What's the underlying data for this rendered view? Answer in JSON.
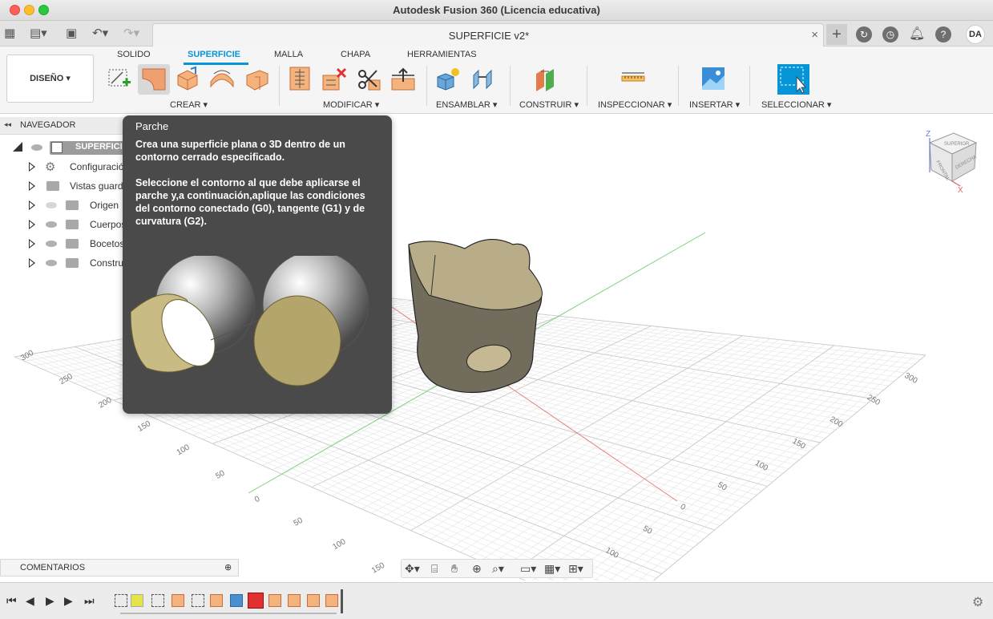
{
  "window": {
    "title": "Autodesk Fusion 360 (Licencia educativa)"
  },
  "tabbar": {
    "document_title": "SUPERFICIE v2*",
    "close_glyph": "×",
    "plus_glyph": "+",
    "user_initials": "DA"
  },
  "ribbon": {
    "workspace": "DISEÑO ▾",
    "tabs": [
      "SOLIDO",
      "SUPERFICIE",
      "MALLA",
      "CHAPA",
      "HERRAMIENTAS"
    ],
    "active_tab": "SUPERFICIE",
    "groups": [
      "CREAR ▾",
      "MODIFICAR ▾",
      "ENSAMBLAR ▾",
      "CONSTRUIR ▾",
      "INSPECCIONAR ▾",
      "INSERTAR ▾",
      "SELECCIONAR ▾"
    ]
  },
  "navigator": {
    "title": "NAVEGADOR",
    "items": [
      {
        "label": "SUPERFICI"
      },
      {
        "label": "Configuració"
      },
      {
        "label": "Vistas guard"
      },
      {
        "label": "Origen"
      },
      {
        "label": "Cuerpos"
      },
      {
        "label": "Bocetos"
      },
      {
        "label": "Constru"
      }
    ]
  },
  "tooltip": {
    "title": "Parche",
    "line1": "Crea una superficie plana o 3D dentro de un contorno cerrado especificado.",
    "line2": "Seleccione el contorno al que debe aplicarse el parche y,a continuación,aplique las condiciones del contorno conectado (G0), tangente (G1) y de curvatura (G2)."
  },
  "viewport": {
    "axis_left": [
      "300",
      "250",
      "200",
      "150",
      "100",
      "50",
      "0",
      "50",
      "100",
      "150"
    ],
    "axis_right": [
      "300",
      "250",
      "200",
      "150",
      "100",
      "50",
      "0",
      "50",
      "100"
    ],
    "viewcube": {
      "top": "SUPERIOR",
      "front": "FRONTAL",
      "right": "DERECHA",
      "z": "Z",
      "x": "X"
    }
  },
  "comments": {
    "label": "COMENTARIOS",
    "add_glyph": "⊕"
  },
  "colors": {
    "accent": "#0696d7",
    "tooltip_bg": "#4a4a4a",
    "model": "#6f6a5c"
  }
}
